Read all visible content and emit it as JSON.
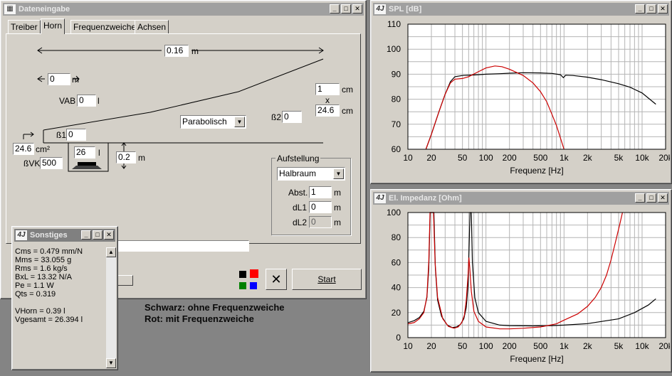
{
  "dateneingabe": {
    "title": "Dateneingabe",
    "tabs": [
      {
        "label": "Treiber"
      },
      {
        "label": "Horn"
      },
      {
        "label": "Frequenzweiche"
      },
      {
        "label": "Achsen"
      }
    ],
    "horn": {
      "length": {
        "value": "0.16",
        "unit": "m"
      },
      "offset": {
        "value": "0",
        "unit": "m"
      },
      "vab": {
        "label": "VAB",
        "value": "0",
        "unit": "l"
      },
      "mouth_w": {
        "value": "1",
        "unit": "cm"
      },
      "times": "x",
      "mouth_h": {
        "value": "24.6",
        "unit": "cm"
      },
      "shape": "Parabolisch",
      "b2": {
        "label": "ß2",
        "value": "0"
      },
      "b1": {
        "label": "ß1",
        "value": "0"
      },
      "area": {
        "value": "24.6",
        "unit": "cm²"
      },
      "bvk": {
        "label": "ßVK",
        "value": "500"
      },
      "chamber": {
        "value": "26",
        "unit": "l"
      },
      "gap": {
        "value": "0.2",
        "unit": "m"
      },
      "aufstellung": {
        "label": "Aufstellung",
        "value": "Halbraum",
        "abst": {
          "label": "Abst.",
          "value": "1",
          "unit": "m"
        },
        "dl1": {
          "label": "dL1",
          "value": "0",
          "unit": "m"
        },
        "dl2": {
          "label": "dL2",
          "value": "0",
          "unit": "m"
        }
      }
    },
    "start_label": "Start",
    "close_glyph": "✕",
    "color_squares": {
      "black": "#000000",
      "red": "#ff0000",
      "green": "#008000",
      "blue": "#0000ff"
    }
  },
  "sonstiges": {
    "title": "Sonstiges",
    "lines": [
      "Cms = 0.479 mm/N",
      "Mms = 33.055 g",
      "Rms = 1.6 kg/s",
      "BxL = 13.32 N/A",
      "Pe = 1.1 W",
      "Qts = 0.319",
      "",
      "VHorn = 0.39 l",
      "Vgesamt = 26.394 l"
    ]
  },
  "legend": {
    "black": "Schwarz: ohne Frequenzweiche",
    "red": "Rot: mit Frequenzweiche"
  },
  "spl_window": {
    "title": "SPL [dB]"
  },
  "imp_window": {
    "title": "El. Impedanz [Ohm]"
  },
  "chart_data": [
    {
      "type": "line",
      "title": "SPL [dB]",
      "xlabel": "Frequenz [Hz]",
      "ylabel": "",
      "xscale": "log",
      "xlim": [
        10,
        20000
      ],
      "ylim": [
        60,
        110
      ],
      "x_ticks": [
        {
          "v": 10,
          "l": "10"
        },
        {
          "v": 20,
          "l": "20"
        },
        {
          "v": 50,
          "l": "50"
        },
        {
          "v": 100,
          "l": "100"
        },
        {
          "v": 200,
          "l": "200"
        },
        {
          "v": 500,
          "l": "500"
        },
        {
          "v": 1000,
          "l": "1k"
        },
        {
          "v": 2000,
          "l": "2k"
        },
        {
          "v": 5000,
          "l": "5k"
        },
        {
          "v": 10000,
          "l": "10k"
        },
        {
          "v": 20000,
          "l": "20k"
        }
      ],
      "y_ticks": [
        60,
        70,
        80,
        90,
        100,
        110
      ],
      "grid": true,
      "series": [
        {
          "color": "#000000",
          "points": [
            [
              17,
              60
            ],
            [
              20,
              66
            ],
            [
              25,
              75
            ],
            [
              30,
              82
            ],
            [
              35,
              87
            ],
            [
              40,
              89
            ],
            [
              50,
              89.5
            ],
            [
              70,
              89.7
            ],
            [
              100,
              90
            ],
            [
              150,
              90.2
            ],
            [
              200,
              90.4
            ],
            [
              300,
              90.6
            ],
            [
              500,
              90.5
            ],
            [
              700,
              90.3
            ],
            [
              900,
              89.8
            ],
            [
              980,
              88.6
            ],
            [
              1050,
              89.6
            ],
            [
              1300,
              89.5
            ],
            [
              2000,
              88.8
            ],
            [
              3000,
              87.8
            ],
            [
              5000,
              86.2
            ],
            [
              7000,
              84.8
            ],
            [
              10000,
              82.5
            ],
            [
              15000,
              78
            ]
          ]
        },
        {
          "color": "#cc0000",
          "points": [
            [
              17,
              60
            ],
            [
              20,
              66
            ],
            [
              25,
              75
            ],
            [
              30,
              82
            ],
            [
              35,
              86.5
            ],
            [
              40,
              88
            ],
            [
              50,
              88.3
            ],
            [
              60,
              89
            ],
            [
              80,
              91
            ],
            [
              100,
              92.5
            ],
            [
              130,
              93.3
            ],
            [
              160,
              93
            ],
            [
              200,
              92
            ],
            [
              300,
              89.5
            ],
            [
              400,
              86.5
            ],
            [
              500,
              83
            ],
            [
              600,
              79
            ],
            [
              700,
              74
            ],
            [
              800,
              69.5
            ],
            [
              900,
              64.5
            ],
            [
              1000,
              60
            ]
          ]
        }
      ]
    },
    {
      "type": "line",
      "title": "El. Impedanz [Ohm]",
      "xlabel": "Frequenz [Hz]",
      "ylabel": "",
      "xscale": "log",
      "xlim": [
        10,
        20000
      ],
      "ylim": [
        0,
        100
      ],
      "x_ticks": [
        {
          "v": 10,
          "l": "10"
        },
        {
          "v": 20,
          "l": "20"
        },
        {
          "v": 50,
          "l": "50"
        },
        {
          "v": 100,
          "l": "100"
        },
        {
          "v": 200,
          "l": "200"
        },
        {
          "v": 500,
          "l": "500"
        },
        {
          "v": 1000,
          "l": "1k"
        },
        {
          "v": 2000,
          "l": "2k"
        },
        {
          "v": 5000,
          "l": "5k"
        },
        {
          "v": 10000,
          "l": "10k"
        },
        {
          "v": 20000,
          "l": "20k"
        }
      ],
      "y_ticks": [
        0,
        20,
        40,
        60,
        80,
        100
      ],
      "grid": true,
      "series": [
        {
          "color": "#000000",
          "points": [
            [
              10,
              12
            ],
            [
              12,
              13.5
            ],
            [
              14,
              16
            ],
            [
              16,
              21
            ],
            [
              17.5,
              32
            ],
            [
              18.5,
              55
            ],
            [
              19.3,
              100
            ],
            [
              21.5,
              100
            ],
            [
              22.5,
              55
            ],
            [
              24,
              30
            ],
            [
              27,
              17
            ],
            [
              32,
              10
            ],
            [
              37,
              8
            ],
            [
              42,
              8.5
            ],
            [
              47,
              10.5
            ],
            [
              52,
              15
            ],
            [
              56,
              24
            ],
            [
              59,
              42
            ],
            [
              61,
              75
            ],
            [
              62.5,
              100
            ],
            [
              65,
              100
            ],
            [
              67,
              60
            ],
            [
              72,
              32
            ],
            [
              80,
              20
            ],
            [
              100,
              13
            ],
            [
              150,
              10
            ],
            [
              200,
              9.6
            ],
            [
              400,
              9.4
            ],
            [
              700,
              9.6
            ],
            [
              1000,
              10
            ],
            [
              2000,
              11.2
            ],
            [
              5000,
              15
            ],
            [
              8000,
              20
            ],
            [
              12000,
              26
            ],
            [
              15000,
              31
            ]
          ]
        },
        {
          "color": "#cc0000",
          "points": [
            [
              10,
              11
            ],
            [
              12,
              12
            ],
            [
              14,
              15
            ],
            [
              16,
              20
            ],
            [
              17.5,
              33
            ],
            [
              18.5,
              60
            ],
            [
              19.2,
              100
            ],
            [
              21.3,
              100
            ],
            [
              22.3,
              60
            ],
            [
              24,
              32
            ],
            [
              28,
              15
            ],
            [
              33,
              9
            ],
            [
              39,
              7.5
            ],
            [
              44,
              8.5
            ],
            [
              49,
              12
            ],
            [
              53,
              18
            ],
            [
              56,
              30
            ],
            [
              59,
              50
            ],
            [
              60.5,
              64
            ],
            [
              62,
              56
            ],
            [
              65,
              37
            ],
            [
              70,
              21
            ],
            [
              80,
              13
            ],
            [
              100,
              8.5
            ],
            [
              150,
              7
            ],
            [
              200,
              7
            ],
            [
              300,
              7.5
            ],
            [
              500,
              8.5
            ],
            [
              800,
              11
            ],
            [
              1000,
              14
            ],
            [
              1500,
              19
            ],
            [
              2000,
              25
            ],
            [
              2500,
              32
            ],
            [
              3000,
              40
            ],
            [
              3500,
              50
            ],
            [
              4000,
              62
            ],
            [
              4500,
              75
            ],
            [
              5200,
              91
            ],
            [
              5600,
              100
            ]
          ]
        }
      ]
    }
  ]
}
